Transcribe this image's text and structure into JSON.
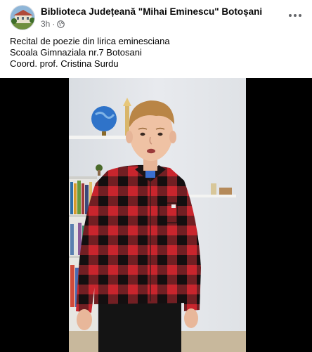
{
  "post": {
    "author": "Biblioteca Județeană \"Mihai Eminescu\" Botoșani",
    "time": "3h",
    "separator": "·",
    "audience_icon": "globe-icon",
    "more_icon": "more-horizontal-icon",
    "text_lines": [
      "Recital de poezie din lirica eminesciana",
      "Scoala Gimnaziala nr.7 Botosani",
      "Coord. prof. Cristina Surdu"
    ]
  },
  "video": {
    "content": "boy-in-plaid-shirt-reciting"
  },
  "colors": {
    "text_primary": "#050505",
    "text_secondary": "#65676b",
    "shirt_red": "#c9252d",
    "shirt_black": "#1a1516",
    "letterbox": "#000000"
  }
}
